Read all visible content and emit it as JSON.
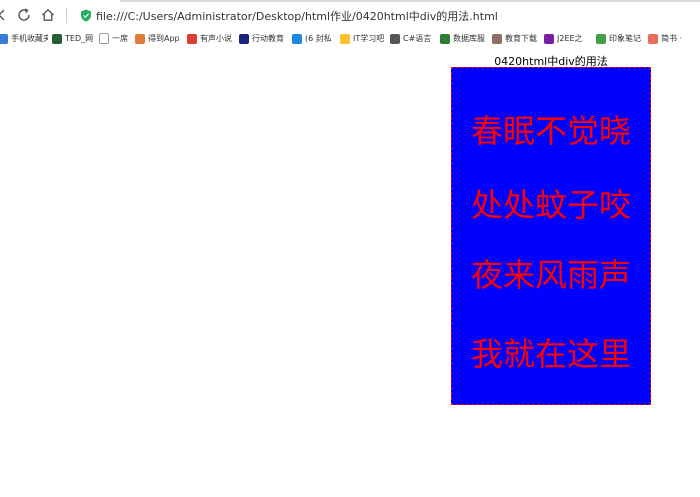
{
  "browser": {
    "address_url": "file:///C:/Users/Administrator/Desktop/html作业/0420html中div的用法.html",
    "icons": {
      "refresh": "refresh-icon",
      "home": "home-icon",
      "security": "shield-icon",
      "back": "back-arrow-icon"
    }
  },
  "bookmarks": [
    {
      "label": "手机收藏夹",
      "icon": "mobile-icon",
      "color": "#3a7bd5"
    },
    {
      "label": "TED_网",
      "icon": "ted-icon",
      "color": "#2b5d34"
    },
    {
      "label": "一席",
      "icon": "page-icon",
      "color": "#9aa0a6"
    },
    {
      "label": "得到App",
      "icon": "dedao-icon",
      "color": "#e07b39"
    },
    {
      "label": "有声小说",
      "icon": "audio-icon",
      "color": "#e53935"
    },
    {
      "label": "行动教育",
      "icon": "action-edu-icon",
      "color": "#1a237e"
    },
    {
      "label": "(6 封私",
      "icon": "zhihu-icon",
      "color": "#1e88e5"
    },
    {
      "label": "IT学习吧",
      "icon": "it-icon",
      "color": "#fbc02d"
    },
    {
      "label": "C#语言",
      "icon": "csharp-icon",
      "color": "#555555"
    },
    {
      "label": "数据库服",
      "icon": "database-icon",
      "color": "#2e7d32"
    },
    {
      "label": "教育下载",
      "icon": "download-icon",
      "color": "#8d6e63"
    },
    {
      "label": "J2EE之",
      "icon": "j2ee-icon",
      "color": "#7b1fa2"
    },
    {
      "label": "印象笔记",
      "icon": "evernote-icon",
      "color": "#43a047"
    },
    {
      "label": "简书 ·",
      "icon": "jianshu-icon",
      "color": "#ea6f5a"
    }
  ],
  "page": {
    "caption": "0420html中div的用法",
    "poem_lines": [
      "春眠不觉晓",
      "处处蚊子咬",
      "夜来风雨声",
      "我就在这里"
    ],
    "box_background": "#0000ff",
    "text_color": "#ff0000"
  }
}
